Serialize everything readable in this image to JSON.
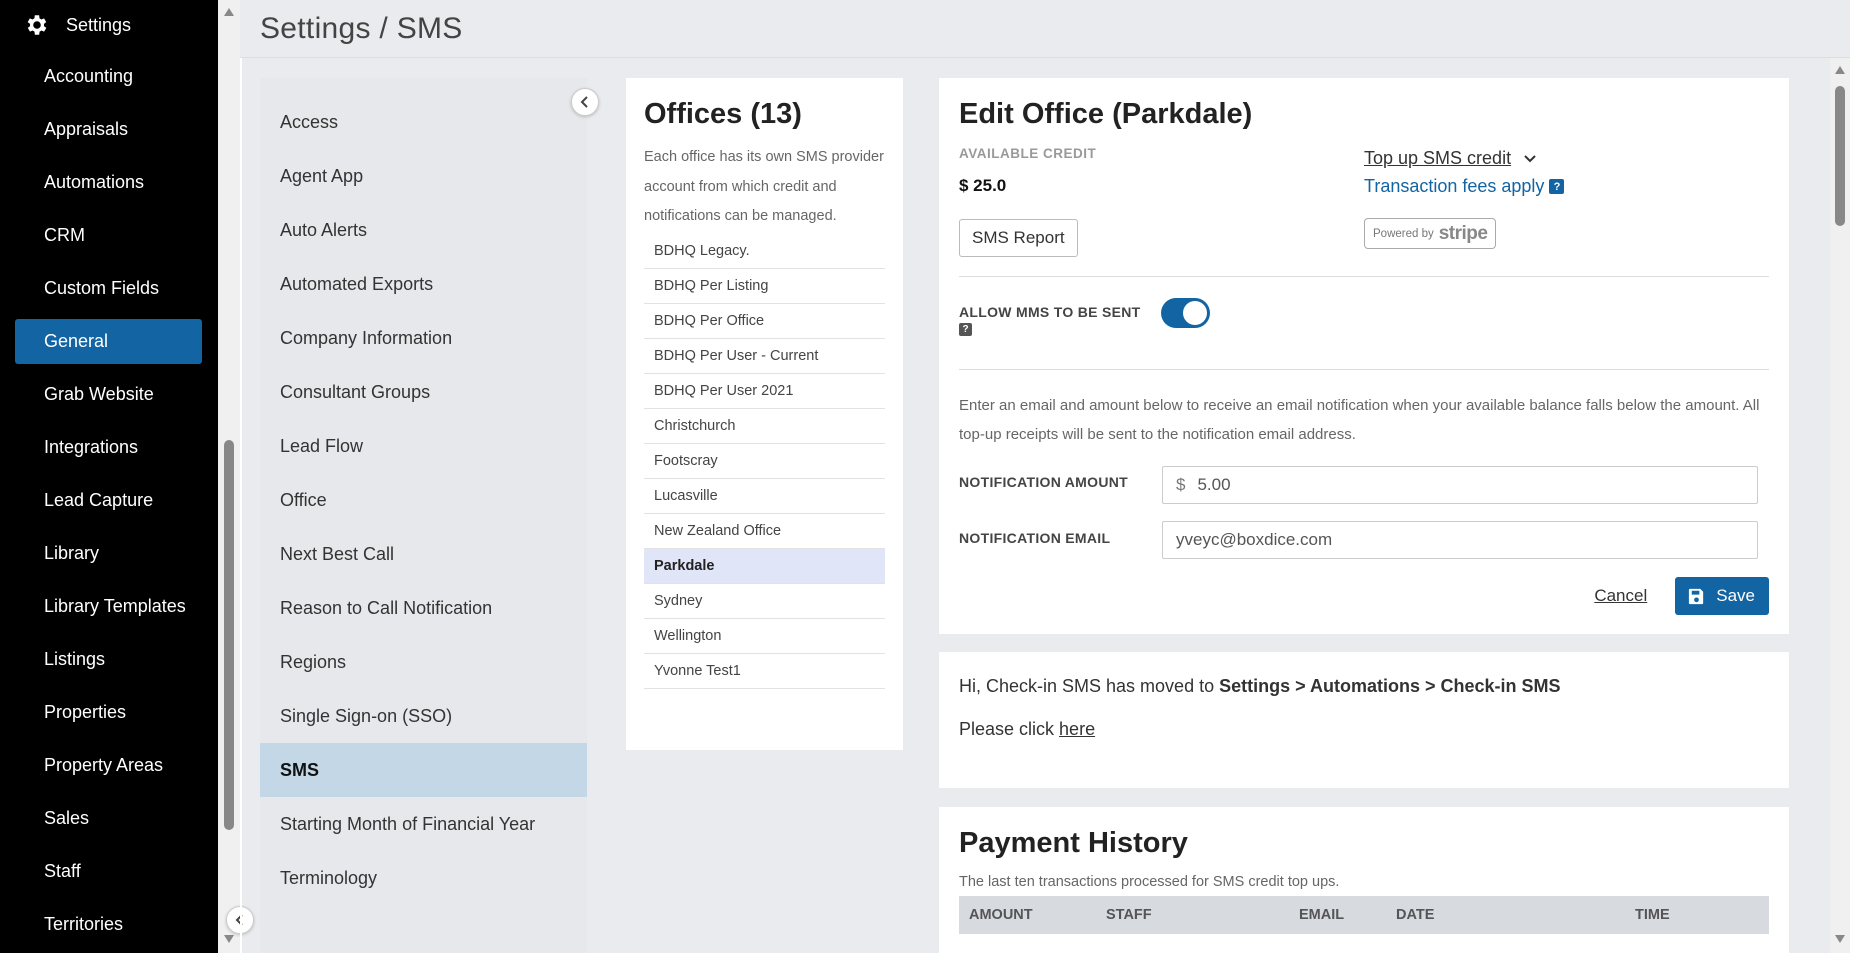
{
  "page": {
    "title": "Settings / SMS"
  },
  "nav": {
    "header_label": "Settings",
    "items": [
      {
        "label": "Accounting"
      },
      {
        "label": "Appraisals"
      },
      {
        "label": "Automations"
      },
      {
        "label": "CRM"
      },
      {
        "label": "Custom Fields"
      },
      {
        "label": "General"
      },
      {
        "label": "Grab Website"
      },
      {
        "label": "Integrations"
      },
      {
        "label": "Lead Capture"
      },
      {
        "label": "Library"
      },
      {
        "label": "Library Templates"
      },
      {
        "label": "Listings"
      },
      {
        "label": "Properties"
      },
      {
        "label": "Property Areas"
      },
      {
        "label": "Sales"
      },
      {
        "label": "Staff"
      },
      {
        "label": "Territories"
      }
    ],
    "active": "General"
  },
  "settings_list": {
    "items": [
      {
        "label": "Access"
      },
      {
        "label": "Agent App"
      },
      {
        "label": "Auto Alerts"
      },
      {
        "label": "Automated Exports"
      },
      {
        "label": "Company Information"
      },
      {
        "label": "Consultant Groups"
      },
      {
        "label": "Lead Flow"
      },
      {
        "label": "Office"
      },
      {
        "label": "Next Best Call"
      },
      {
        "label": "Reason to Call Notification"
      },
      {
        "label": "Regions"
      },
      {
        "label": "Single Sign-on (SSO)"
      },
      {
        "label": "SMS"
      },
      {
        "label": "Starting Month of Financial Year"
      },
      {
        "label": "Terminology"
      }
    ],
    "active": "SMS"
  },
  "offices": {
    "title": "Offices (13)",
    "description": "Each office has its own SMS provider account from which credit and notifications can be managed.",
    "items": [
      {
        "label": "BDHQ Legacy."
      },
      {
        "label": "BDHQ Per Listing"
      },
      {
        "label": "BDHQ Per Office"
      },
      {
        "label": "BDHQ Per User - Current"
      },
      {
        "label": "BDHQ Per User 2021"
      },
      {
        "label": "Christchurch"
      },
      {
        "label": "Footscray"
      },
      {
        "label": "Lucasville"
      },
      {
        "label": "New Zealand Office"
      },
      {
        "label": "Parkdale"
      },
      {
        "label": "Sydney"
      },
      {
        "label": "Wellington"
      },
      {
        "label": "Yvonne Test1"
      }
    ],
    "active": "Parkdale"
  },
  "edit": {
    "title": "Edit Office (Parkdale)",
    "available_credit_label": "AVAILABLE CREDIT",
    "available_credit_value": "$ 25.0",
    "sms_report_label": "SMS Report",
    "top_up_label": "Top up SMS credit",
    "transaction_fees_label": "Transaction fees apply",
    "help_mark": "?",
    "stripe_powered": "Powered by",
    "stripe_brand": "stripe",
    "allow_mms_label": "ALLOW MMS TO BE SENT",
    "allow_mms_on": true,
    "help_text": "Enter an email and amount below to receive an email notification when your available balance falls below the amount. All top-up receipts will be sent to the notification email address.",
    "notification_amount_label": "NOTIFICATION AMOUNT",
    "currency_symbol": "$",
    "notification_amount_value": "5.00",
    "notification_email_label": "NOTIFICATION EMAIL",
    "notification_email_value": "yveyc@boxdice.com",
    "cancel_label": "Cancel",
    "save_label": "Save",
    "accent": "#1264a3"
  },
  "notice": {
    "line1_prefix": "Hi, Check-in SMS has moved to ",
    "line1_path": "Settings > Automations > Check-in SMS",
    "line2_prefix": "Please click ",
    "line2_link": "here"
  },
  "payment": {
    "title": "Payment History",
    "description": "The last ten transactions processed for SMS credit top ups.",
    "columns": [
      "AMOUNT",
      "STAFF",
      "EMAIL",
      "DATE",
      "TIME"
    ]
  }
}
